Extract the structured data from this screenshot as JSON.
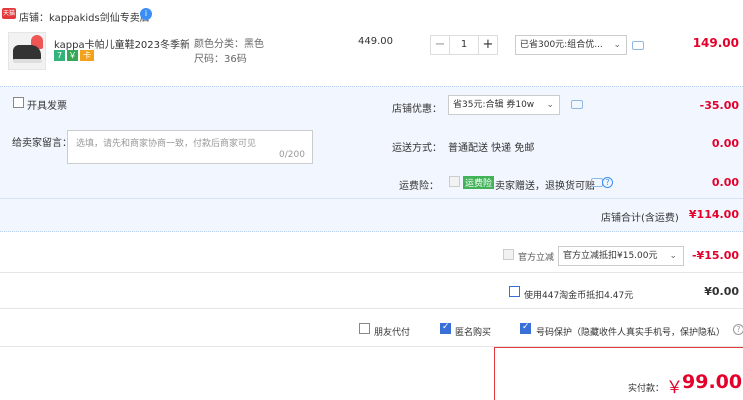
{
  "shop": {
    "badge": "天猫",
    "name": "店铺：kappakids剑仙专卖店",
    "wangwang": "i"
  },
  "item": {
    "title": "kappa卡帕儿童鞋2023冬季新...",
    "tags": [
      "7",
      "￥",
      "卡"
    ],
    "sku_color": "颜色分类：黑色",
    "sku_size": "尺码：36码",
    "unit_price": "449.00",
    "quantity": "1",
    "minus": "−",
    "plus": "+",
    "discount_selected": "已省300元:组合优...",
    "total": "149.00"
  },
  "invoice": {
    "label": "开具发票"
  },
  "memo": {
    "label": "给卖家留言：",
    "placeholder": "选填，请先和商家协商一致，付款后商家可见",
    "counter": "0/200"
  },
  "shop_coupon": {
    "label": "店铺优惠：",
    "selected": "省35元:合辑 券10w",
    "value": "-35.00"
  },
  "shipping": {
    "label": "运送方式：",
    "method": "普通配送 快递 免邮",
    "value": "0.00"
  },
  "freight_insurance": {
    "label": "运费险：",
    "tag": "运费险",
    "desc": "卖家赠送，退换货可赔",
    "value": "0.00"
  },
  "subtotal": {
    "label": "店铺合计(含运费)",
    "value": "¥114.00"
  },
  "official_discount": {
    "label": "官方立减",
    "selected": "官方立减抵扣¥15.00元",
    "value": "-¥15.00"
  },
  "taojinbi": {
    "label": "使用447淘金币抵扣4.47元",
    "value": "¥0.00"
  },
  "options": {
    "friend_pay": "朋友代付",
    "anonymous": "匿名购买",
    "number_protect": "号码保护（隐藏收件人真实手机号，保护隐私）"
  },
  "payment": {
    "label": "实付款：",
    "currency": "￥",
    "amount": "99.00"
  },
  "chevron": "⌄"
}
